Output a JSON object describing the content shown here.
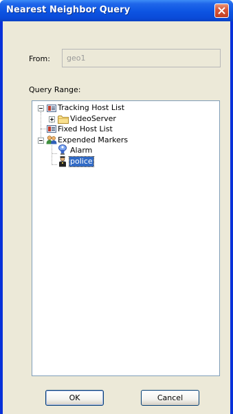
{
  "window": {
    "title": "Nearest Neighbor Query"
  },
  "from": {
    "label": "From:",
    "value": "geo1"
  },
  "query_range": {
    "label": "Query Range:"
  },
  "tree": {
    "tracking_host_list": "Tracking Host List",
    "video_server": "VideoServer",
    "fixed_host_list": "Fixed Host List",
    "expended_markers": "Expended Markers",
    "alarm": "Alarm",
    "police": "police"
  },
  "buttons": {
    "ok": "OK",
    "cancel": "Cancel"
  },
  "colors": {
    "titlebar": "#0a4ad8",
    "selection": "#316ac5",
    "dialog_bg": "#ece9d8"
  }
}
